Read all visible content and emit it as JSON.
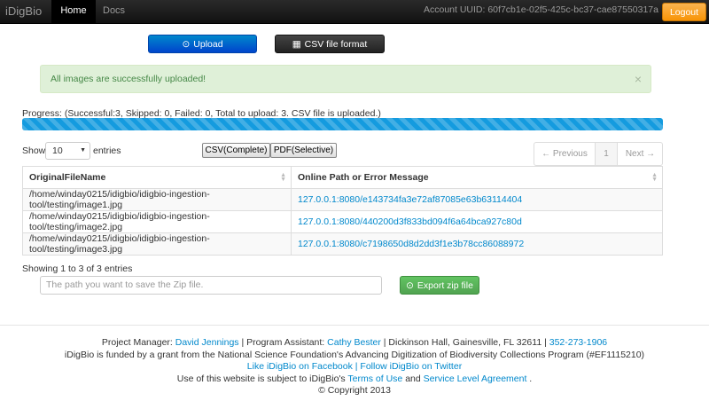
{
  "navbar": {
    "brand": "iDigBio",
    "items": [
      {
        "label": "Home",
        "active": true
      },
      {
        "label": "Docs",
        "active": false
      }
    ],
    "account": "Account UUID: 60f7cb1e-02f5-425c-bc37-cae87550317a",
    "logout": "Logout"
  },
  "actions": {
    "upload": "Upload",
    "upload_icon": "upload-circle-icon",
    "csv_format": "CSV file format",
    "csv_icon": "table-icon"
  },
  "alert": {
    "message": "All images are successfully uploaded!",
    "close": "×"
  },
  "progress": {
    "text": "Progress: (Successful:3, Skipped: 0, Failed: 0, Total to upload: 3. CSV file is uploaded.)",
    "percent": 100,
    "color": "#149bdf"
  },
  "table_controls": {
    "show": "Show",
    "page_size": "10",
    "entries": "entries",
    "export_csv": "CSV(Complete)",
    "export_pdf": "PDF(Selective)",
    "prev": "← Previous",
    "page": "1",
    "next": "Next →"
  },
  "table": {
    "headers": [
      "OriginalFileName",
      "Online Path or Error Message"
    ],
    "rows": [
      [
        "/home/winday0215/idigbio/idigbio-ingestion-tool/testing/image1.jpg",
        "127.0.0.1:8080/e143734fa3e72af87085e63b63114404"
      ],
      [
        "/home/winday0215/idigbio/idigbio-ingestion-tool/testing/image2.jpg",
        "127.0.0.1:8080/440200d3f833bd094f6a64bca927c80d"
      ],
      [
        "/home/winday0215/idigbio/idigbio-ingestion-tool/testing/image3.jpg",
        "127.0.0.1:8080/c7198650d8d2dd3f1e3b78cc86088972"
      ]
    ]
  },
  "showing": "Showing 1 to 3 of 3 entries",
  "zip": {
    "placeholder": "The path you want to save the Zip file.",
    "button": "Export zip file"
  },
  "footer": {
    "pm_label": "Project Manager: ",
    "pm_name": "David Jennings",
    "pa_label": " | Program Assistant: ",
    "pa_name": "Cathy Bester",
    "address": " | Dickinson Hall, Gainesville, FL 32611 | ",
    "phone": "352-273-1906",
    "funding": "iDigBio is funded by a grant from the National Science Foundation's Advancing Digitization of Biodiversity Collections Program (#EF1115210)",
    "facebook": "Like iDigBio on Facebook",
    "divider": " | ",
    "twitter": "Follow iDigBio on Twitter",
    "terms_pre": "Use of this website is subject to iDigBio's ",
    "terms": "Terms of Use",
    "and": " and ",
    "sla": "Service Level Agreement",
    "period": " .",
    "copyright": "© Copyright 2013"
  }
}
